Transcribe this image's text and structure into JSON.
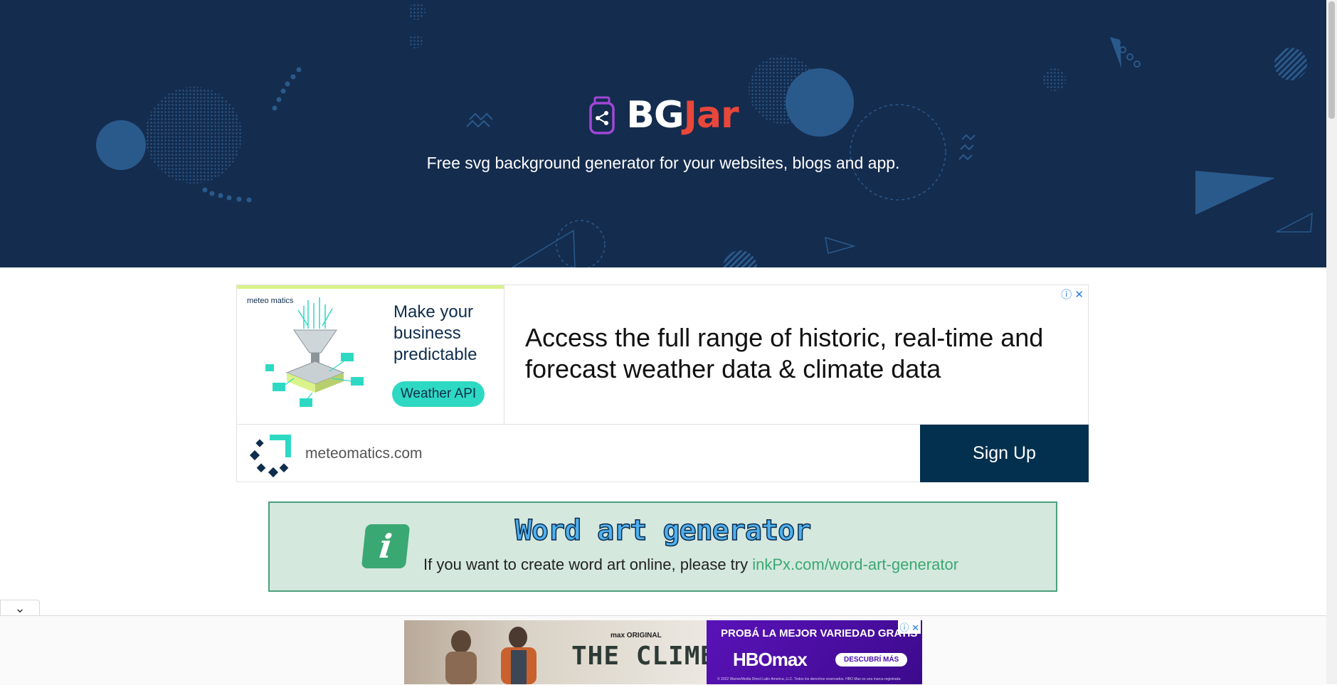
{
  "hero": {
    "brand_part1": "BG",
    "brand_part2": "Jar",
    "tagline": "Free svg background generator for your websites, blogs and app.",
    "colors": {
      "background": "#142c4e",
      "accent": "#e8473b",
      "decor": "#2a5a8c"
    }
  },
  "ad_top": {
    "brand_small": "meteo matics",
    "image_text": "Make your business predictable",
    "image_button": "Weather API",
    "headline": "Access the full range of historic, real-time and forecast weather data & climate data",
    "domain": "meteomatics.com",
    "cta": "Sign Up",
    "ad_icons": "ⓘ ✕"
  },
  "promo": {
    "icon_letter": "i",
    "title": "Word art generator",
    "text": "If you want to create word art online, please try ",
    "link": "inkPx.com/word-art-generator"
  },
  "collapse_tab": {
    "icon": "chevron-down-icon",
    "glyph": "⌄"
  },
  "ad_bottom": {
    "max_original": "max ORIGINAL",
    "show_title": "THE CLIMB",
    "headline": "PROBÁ LA MEJOR VARIEDAD GRATIS",
    "brand": "HBOmax",
    "cta": "DESCUBRÍ MÁS",
    "fine_print": "© 2022 WarnerMedia Direct Latin America, LLC. Todos los derechos reservados. HBO Max es una marca registrada.",
    "ad_icons": "ⓘ ✕"
  }
}
